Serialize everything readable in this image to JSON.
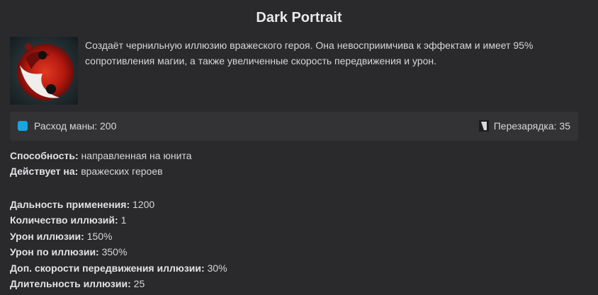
{
  "ability": {
    "title": "Dark Portrait",
    "icon": "dark-portrait-icon",
    "description": "Создаёт чернильную иллюзию вражеского героя. Она невосприимчива к эффектам и имеет 95% сопротивления магии, а также увеличенные скорость передвижения и урон."
  },
  "stats": {
    "mana_label": "Расход маны: 200",
    "mana_color": "#14a6dc",
    "cooldown_label": "Перезарядка: 35"
  },
  "properties_group1": [
    {
      "label": "Способность:",
      "value": "направленная на юнита"
    },
    {
      "label": "Действует на:",
      "value": "вражеских героев"
    }
  ],
  "properties_group2": [
    {
      "label": "Дальность применения:",
      "value": "1200"
    },
    {
      "label": "Количество иллюзий:",
      "value": "1"
    },
    {
      "label": "Урон иллюзии:",
      "value": "150%"
    },
    {
      "label": "Урон по иллюзии:",
      "value": "350%"
    },
    {
      "label": "Доп. скорости передвижения иллюзии:",
      "value": "30%"
    },
    {
      "label": "Длительность иллюзии:",
      "value": "25"
    }
  ]
}
